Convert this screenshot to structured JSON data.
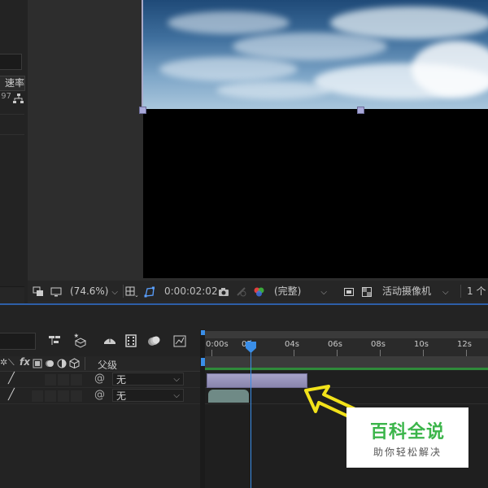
{
  "project": {
    "header_cell": "速率",
    "fps_fragment": "97"
  },
  "viewer_toolbar": {
    "zoom": "(74.6%)",
    "timecode": "0:00:02:02",
    "resolution": "(完整)",
    "camera": "活动摄像机",
    "views": "1 个"
  },
  "timeline": {
    "parent_header": "父级",
    "ruler_ticks": [
      "0:00s",
      "02s",
      "04s",
      "06s",
      "08s",
      "10s",
      "12s"
    ],
    "layers": [
      {
        "parent_value": "无"
      },
      {
        "parent_value": "无"
      }
    ],
    "icons": [
      "comp-flowchart-icon",
      "draft-3d-icon",
      "shy-layers-icon",
      "frame-blending-icon",
      "motion-blur-icon",
      "graph-editor-icon"
    ]
  },
  "watermark": {
    "title": "百科全说",
    "subtitle": "助你轻松解决"
  },
  "colors": {
    "accent_blue": "#3a8ee8",
    "clip_lavender": "#a6a2c8",
    "clip_teal": "#6f8a86",
    "work_area_green": "#2f8a3a",
    "arrow_yellow": "#f2e21a",
    "watermark_green": "#3bb54a"
  }
}
